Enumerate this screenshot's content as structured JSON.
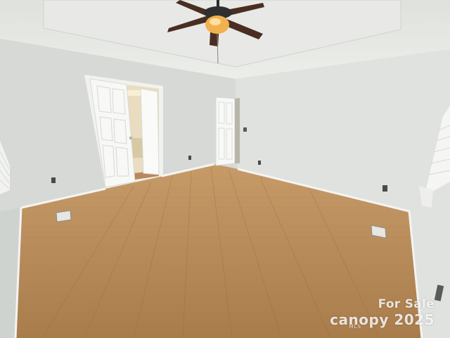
{
  "photo": {
    "subject": "empty-bedroom",
    "colors": {
      "wall_left": "#d7dad6",
      "wall_right": "#e0e3df",
      "ceiling": "#e4e5e2",
      "floor": "#b98f5f",
      "trim": "#f4f4f2",
      "fan_blade": "#4a2e22",
      "fan_light": "#f2b14e"
    }
  },
  "watermark": {
    "line1": "For Sale",
    "brand": "canopy",
    "suffix": "MLS",
    "year": "2025"
  }
}
